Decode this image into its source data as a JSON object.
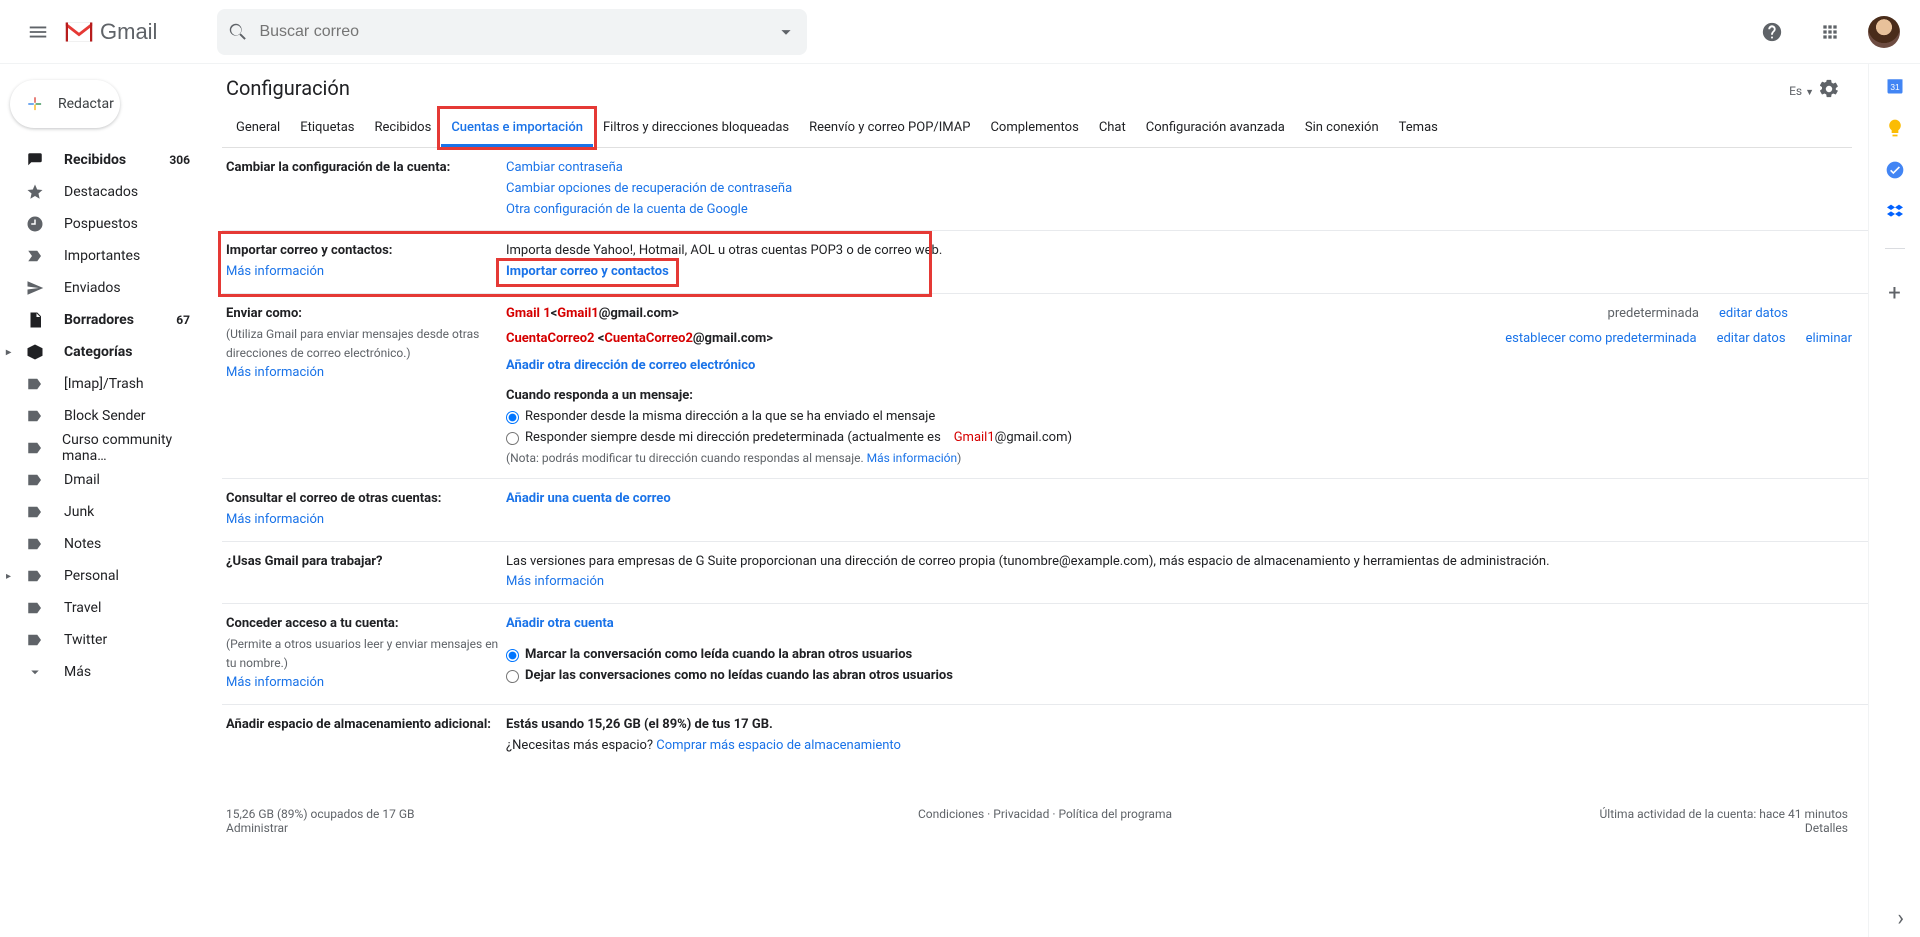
{
  "header": {
    "logo_text": "Gmail",
    "search_placeholder": "Buscar correo"
  },
  "compose_label": "Redactar",
  "nav": {
    "recibidos": {
      "label": "Recibidos",
      "count": "306"
    },
    "destacados": "Destacados",
    "pospuestos": "Pospuestos",
    "importantes": "Importantes",
    "enviados": "Enviados",
    "borradores": {
      "label": "Borradores",
      "count": "67"
    },
    "categorias": "Categorías",
    "imap_trash": "[Imap]/Trash",
    "block_sender": "Block Sender",
    "curso": "Curso community mana…",
    "dmail": "Dmail",
    "junk": "Junk",
    "notes": "Notes",
    "personal": "Personal",
    "travel": "Travel",
    "twitter": "Twitter",
    "mas": "Más"
  },
  "settings": {
    "title": "Configuración",
    "lang": "Es",
    "tabs": {
      "general": "General",
      "etiquetas": "Etiquetas",
      "recibidos": "Recibidos",
      "cuentas": "Cuentas e importación",
      "filtros": "Filtros y direcciones bloqueadas",
      "reenvio": "Reenvío y correo POP/IMAP",
      "complementos": "Complementos",
      "chat": "Chat",
      "avanzada": "Configuración avanzada",
      "sin_conexion": "Sin conexión",
      "temas": "Temas"
    }
  },
  "sections": {
    "cambiar_config": {
      "title": "Cambiar la configuración de la cuenta:",
      "link1": "Cambiar contraseña",
      "link2": "Cambiar opciones de recuperación de contraseña",
      "link3": "Otra configuración de la cuenta de Google"
    },
    "importar": {
      "title": "Importar correo y contactos:",
      "mas_info": "Más información",
      "desc": "Importa desde Yahoo!, Hotmail, AOL u otras cuentas POP3 o de correo web.",
      "link": "Importar correo y contactos"
    },
    "enviar_como": {
      "title": "Enviar como:",
      "subtitle": "(Utiliza Gmail para enviar mensajes desde otras direcciones de correo electrónico.)",
      "mas_info": "Más información",
      "row1_name": "Gmail 1",
      "row1_email_red": "Gmail1",
      "row1_email_rest": "@gmail.com>",
      "row1_prefix": "<",
      "row1_status": "predeterminada",
      "row1_edit": "editar datos",
      "row2_name": "CuentaCorreo2 ",
      "row2_email_red": "CuentaCorreo2",
      "row2_email_rest": "@gmail.com>",
      "row2_prefix": "<",
      "row2_setdefault": "establecer como predeterminada",
      "row2_edit": "editar datos",
      "row2_delete": "eliminar",
      "add_link": "Añadir otra dirección de correo electrónico",
      "reply_title": "Cuando responda a un mensaje:",
      "reply_opt1": "Responder desde la misma dirección a la que se ha enviado el mensaje",
      "reply_opt2_a": "Responder siempre desde mi dirección predeterminada (actualmente es",
      "reply_opt2_red": "Gmail1",
      "reply_opt2_b": "@gmail.com)",
      "reply_note": "(Nota: podrás modificar tu dirección cuando respondas al mensaje. ",
      "reply_note_link": "Más información",
      "reply_note_end": ")"
    },
    "consultar": {
      "title": "Consultar el correo de otras cuentas:",
      "mas_info": "Más información",
      "link": "Añadir una cuenta de correo"
    },
    "gsuite": {
      "title": "¿Usas Gmail para trabajar?",
      "desc": "Las versiones para empresas de G Suite proporcionan una dirección de correo propia (tunombre@example.com), más espacio de almacenamiento y herramientas de administración.",
      "link": "Más información"
    },
    "conceder": {
      "title": "Conceder acceso a tu cuenta:",
      "subtitle": "(Permite a otros usuarios leer y enviar mensajes en tu nombre.)",
      "mas_info": "Más información",
      "link": "Añadir otra cuenta",
      "opt1": "Marcar la conversación como leída cuando la abran otros usuarios",
      "opt2": "Dejar las conversaciones como no leídas cuando las abran otros usuarios"
    },
    "storage": {
      "title": "Añadir espacio de almacenamiento adicional:",
      "desc_a": "Estás usando 15,26 GB (el 89%) de tus 17 GB.",
      "desc_b": "¿Necesitas más espacio? ",
      "link": "Comprar más espacio de almacenamiento"
    }
  },
  "footer": {
    "left_a": "15,26 GB (89%) ocupados de 17 GB",
    "left_b": "Administrar",
    "center_a": "Condiciones",
    "center_b": "Privacidad",
    "center_c": "Política del programa",
    "right_a": "Última actividad de la cuenta: hace 41 minutos",
    "right_b": "Detalles"
  }
}
